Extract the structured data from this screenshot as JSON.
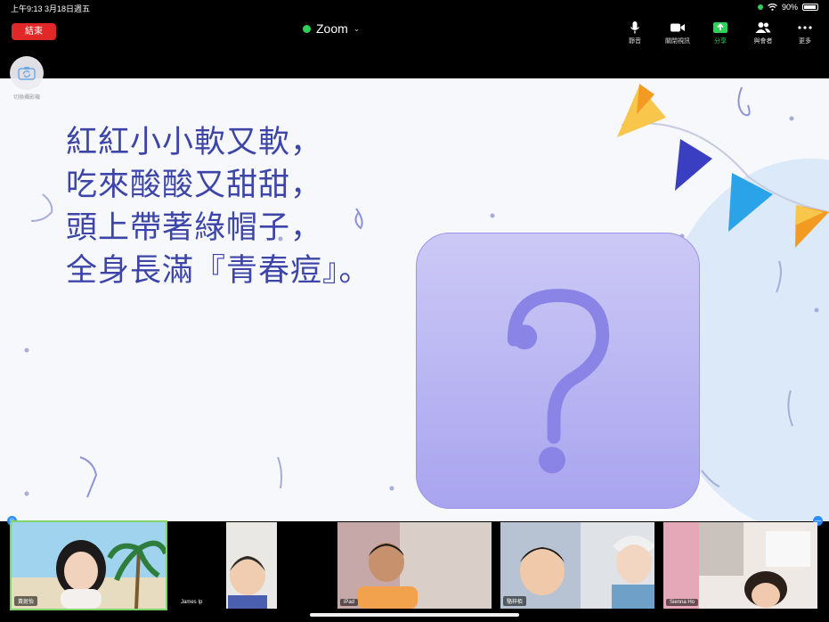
{
  "status_bar": {
    "time_date": "上午9:13   3月18日週五",
    "battery": "90%",
    "battery_level": 0.9
  },
  "toolbar": {
    "end_label": "結束",
    "meeting_title": "Zoom",
    "buttons": [
      {
        "label": "靜音",
        "icon": "microphone-icon"
      },
      {
        "label": "關閉視訊",
        "icon": "video-camera-icon"
      },
      {
        "label": "分享",
        "icon": "share-screen-icon"
      },
      {
        "label": "與會者",
        "icon": "participants-icon"
      },
      {
        "label": "更多",
        "icon": "more-icon"
      }
    ],
    "colors": {
      "end": "#e02828",
      "share": "#2fd159"
    }
  },
  "camera_switch": {
    "label": "切換攝影機"
  },
  "slide": {
    "riddle_lines": [
      "紅紅小小軟又軟，",
      "吃來酸酸又甜甜，",
      "頭上帶著綠帽子，",
      "全身長滿『青春痘』。"
    ],
    "question_mark": "?",
    "text_color": "#3d46a8"
  },
  "gallery": {
    "tiles": [
      {
        "name": "黃斑怡",
        "active": true
      },
      {
        "name": "James Ip",
        "active": false
      },
      {
        "name": "iPad",
        "active": false
      },
      {
        "name": "駱梓栢",
        "active": false
      },
      {
        "name": "Sienna Ho",
        "active": false
      }
    ]
  }
}
